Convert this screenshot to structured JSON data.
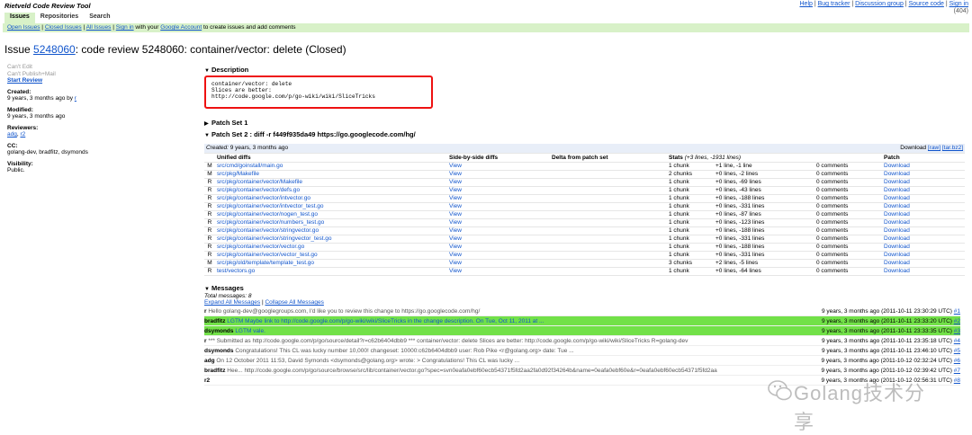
{
  "app_title": "Rietveld Code Review Tool",
  "top_links": [
    "Help",
    "Bug tracker",
    "Discussion group",
    "Source code",
    "Sign in"
  ],
  "version": "(404)",
  "tabs": [
    "Issues",
    "Repositories",
    "Search"
  ],
  "subnav": {
    "links": [
      "Open Issues",
      "Closed Issues",
      "All Issues",
      "Sign in"
    ],
    "text_pre_google": " with your ",
    "google_link": "Google Account",
    "text_post": " to create issues and add comments"
  },
  "issue": {
    "prefix": "Issue ",
    "number": "5248060",
    "title": ": code review 5248060: container/vector: delete (Closed)"
  },
  "sidebar": {
    "cant_edit": "Can't Edit",
    "cant_publish": "Can't Publish+Mail",
    "start_review": "Start Review",
    "created_label": "Created:",
    "created_value": "9 years, 3 months ago by ",
    "created_by": "r",
    "modified_label": "Modified:",
    "modified_value": "9 years, 3 months ago",
    "reviewers_label": "Reviewers:",
    "reviewers": [
      "adg",
      "r2"
    ],
    "cc_label": "CC:",
    "cc_value": "golang-dev, bradfitz, dsymonds",
    "visibility_label": "Visibility:",
    "visibility_value": "Public."
  },
  "description": {
    "heading": "Description",
    "line1": "container/vector: delete",
    "line2": "Slices are better:",
    "line3": "http://code.google.com/p/go-wiki/wiki/SliceTricks"
  },
  "patch_set_1": "Patch Set 1",
  "patch_set_2": "Patch Set 2 : diff -r f449f935da49 https://go.googlecode.com/hg/",
  "files_table": {
    "created_label": "Created:",
    "created_value": " 9 years, 3 months ago",
    "download_label": "Download ",
    "download_raw": "[raw]",
    "download_tar": "[tar.bz2]",
    "headers": {
      "unified": "Unified diffs",
      "side": "Side-by-side diffs",
      "delta": "Delta from patch set",
      "stats_prefix": "Stats ",
      "stats_detail": "(+3 lines, -1931 lines)",
      "patch": "Patch"
    },
    "rows": [
      {
        "st": "M",
        "file": "src/cmd/goinstall/main.go",
        "view": "View",
        "chunks": "1 chunk",
        "lines": "+1 line, -1 line",
        "comments": "0 comments",
        "dl": "Download"
      },
      {
        "st": "M",
        "file": "src/pkg/Makefile",
        "view": "View",
        "chunks": "2 chunks",
        "lines": "+0 lines, -2 lines",
        "comments": "0 comments",
        "dl": "Download"
      },
      {
        "st": "R",
        "file": "src/pkg/container/vector/Makefile",
        "view": "View",
        "chunks": "1 chunk",
        "lines": "+0 lines, -69 lines",
        "comments": "0 comments",
        "dl": "Download"
      },
      {
        "st": "R",
        "file": "src/pkg/container/vector/defs.go",
        "view": "View",
        "chunks": "1 chunk",
        "lines": "+0 lines, -43 lines",
        "comments": "0 comments",
        "dl": "Download"
      },
      {
        "st": "R",
        "file": "src/pkg/container/vector/intvector.go",
        "view": "View",
        "chunks": "1 chunk",
        "lines": "+0 lines, -188 lines",
        "comments": "0 comments",
        "dl": "Download"
      },
      {
        "st": "R",
        "file": "src/pkg/container/vector/intvector_test.go",
        "view": "View",
        "chunks": "1 chunk",
        "lines": "+0 lines, -331 lines",
        "comments": "0 comments",
        "dl": "Download"
      },
      {
        "st": "R",
        "file": "src/pkg/container/vector/nogen_test.go",
        "view": "View",
        "chunks": "1 chunk",
        "lines": "+0 lines, -87 lines",
        "comments": "0 comments",
        "dl": "Download"
      },
      {
        "st": "R",
        "file": "src/pkg/container/vector/numbers_test.go",
        "view": "View",
        "chunks": "1 chunk",
        "lines": "+0 lines, -123 lines",
        "comments": "0 comments",
        "dl": "Download"
      },
      {
        "st": "R",
        "file": "src/pkg/container/vector/stringvector.go",
        "view": "View",
        "chunks": "1 chunk",
        "lines": "+0 lines, -188 lines",
        "comments": "0 comments",
        "dl": "Download"
      },
      {
        "st": "R",
        "file": "src/pkg/container/vector/stringvector_test.go",
        "view": "View",
        "chunks": "1 chunk",
        "lines": "+0 lines, -331 lines",
        "comments": "0 comments",
        "dl": "Download"
      },
      {
        "st": "R",
        "file": "src/pkg/container/vector/vector.go",
        "view": "View",
        "chunks": "1 chunk",
        "lines": "+0 lines, -188 lines",
        "comments": "0 comments",
        "dl": "Download"
      },
      {
        "st": "R",
        "file": "src/pkg/container/vector/vector_test.go",
        "view": "View",
        "chunks": "1 chunk",
        "lines": "+0 lines, -331 lines",
        "comments": "0 comments",
        "dl": "Download"
      },
      {
        "st": "M",
        "file": "src/pkg/old/template/template_test.go",
        "view": "View",
        "chunks": "3 chunks",
        "lines": "+2 lines, -5 lines",
        "comments": "0 comments",
        "dl": "Download"
      },
      {
        "st": "R",
        "file": "test/vectors.go",
        "view": "View",
        "chunks": "1 chunk",
        "lines": "+0 lines, -64 lines",
        "comments": "0 comments",
        "dl": "Download"
      }
    ]
  },
  "messages": {
    "heading": "Messages",
    "total": "Total messages: 8",
    "expand_all": "Expand All Messages",
    "collapse_all": "Collapse All Messages",
    "items": [
      {
        "who": "r",
        "text": " Hello golang-dev@googlegroups.com, I'd like you to review this change to https://go.googlecode.com/hg/",
        "when": "9 years, 3 months ago (2011-10-11 23:30:29 UTC) ",
        "num": "#1",
        "hl": false
      },
      {
        "who": "bradfitz",
        "text": " LGTM Maybe link to http://code.google.com/p/go-wiki/wiki/SliceTricks in the change description. On Tue, Oct 11, 2011 at ...",
        "when": "9 years, 3 months ago (2011-10-11 23:33:20 UTC) ",
        "num": "#2",
        "hl": true
      },
      {
        "who": "dsymonds",
        "text": " LGTM vale.",
        "when": "9 years, 3 months ago (2011-10-11 23:33:35 UTC) ",
        "num": "#3",
        "hl": true
      },
      {
        "who": "r",
        "text": " *** Submitted as http://code.google.com/p/go/source/detail?r=c62b6404dbb9 *** container/vector: delete Slices are better: http://code.google.com/p/go-wiki/wiki/SliceTricks R=golang-dev",
        "when": "9 years, 3 months ago (2011-10-11 23:35:18 UTC) ",
        "num": "#4",
        "hl": false
      },
      {
        "who": "dsymonds",
        "text": " Congratulations! This CL was lucky number 10,000! changeset: 10000:c62b6404dbb9 user: Rob Pike <r@golang.org> date: Tue ...",
        "when": "9 years, 3 months ago (2011-10-11 23:46:10 UTC) ",
        "num": "#5",
        "hl": false
      },
      {
        "who": "adg",
        "text": " On 12 October 2011 11:53, David Symonds <dsymonds@golang.org> wrote: > Congratulations! This CL was lucky ...",
        "when": "9 years, 3 months ago (2011-10-12 02:32:24 UTC) ",
        "num": "#6",
        "hl": false
      },
      {
        "who": "bradfitz",
        "text": " Hee... http://code.google.com/p/go/source/browse/src/lib/container/vector.go?spec=svn0eafa0ebf60ecb54371f5fd2aa2fa0d92f34264b&name=0eafa0ebf60e&r=0eafa0ebf60ecb54371f5fd2aa",
        "when": "9 years, 3 months ago (2011-10-12 02:39:42 UTC) ",
        "num": "#7",
        "hl": false
      },
      {
        "who": "r2",
        "text": "",
        "when": "9 years, 3 months ago (2011-10-12 02:56:31 UTC) ",
        "num": "#8",
        "hl": false
      }
    ]
  },
  "watermark_text": "Golang技术分享"
}
